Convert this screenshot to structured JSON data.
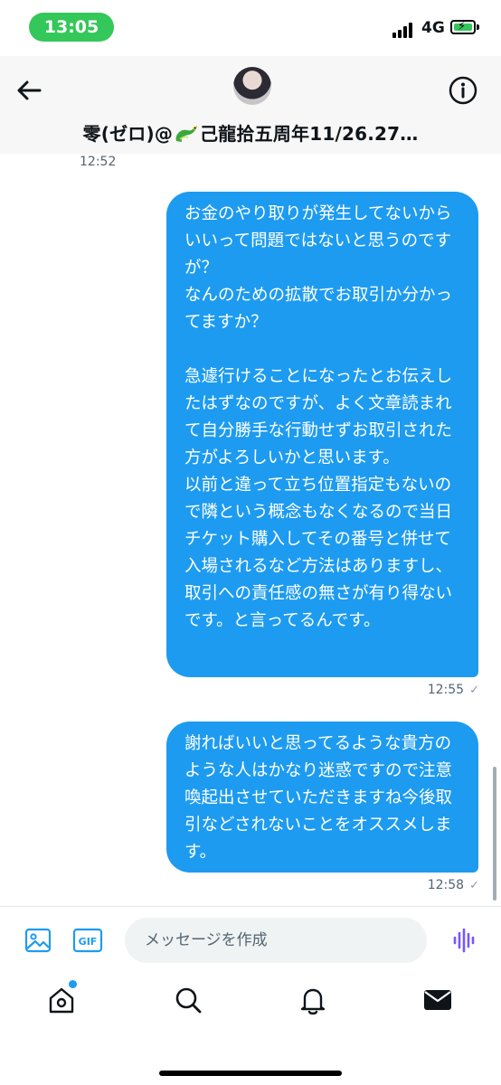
{
  "status_bar": {
    "time": "13:05",
    "network": "4G"
  },
  "header": {
    "title_prefix": "零(ゼロ)@",
    "title_suffix": "己龍拾五周年11/26.27…",
    "back_icon": "arrow-left-icon",
    "info_icon": "info-icon"
  },
  "messages": {
    "previous_timestamp": "12:52",
    "items": [
      {
        "text": "お金のやり取りが発生してないからいいって問題ではないと思うのですが？\nなんのための拡散でお取引か分かってますか？\n\n急遽行けることになったとお伝えしたはずなのですが、よく文章読まれて自分勝手な行動せずお取引された方がよろしいかと思います。\n以前と違って立ち位置指定もないので隣という概念もなくなるので当日チケット購入してその番号と併せて入場されるなど方法はありますし、取引への責任感の無さが有り得ないです。と言ってるんです。",
        "timestamp": "12:55"
      },
      {
        "text": "謝ればいいと思ってるような貴方のような人はかなり迷惑ですので注意喚起出させていただきますね今後取引などされないことをオススメします。",
        "timestamp": "12:58"
      }
    ]
  },
  "composer": {
    "placeholder": "メッセージを作成",
    "gif_label": "GIF"
  },
  "tabbar": {
    "items": [
      "home-icon",
      "search-icon",
      "bell-icon",
      "mail-icon"
    ]
  },
  "colors": {
    "accent": "#1d9bf0",
    "voice": "#7856ff",
    "status_green": "#34c759"
  }
}
